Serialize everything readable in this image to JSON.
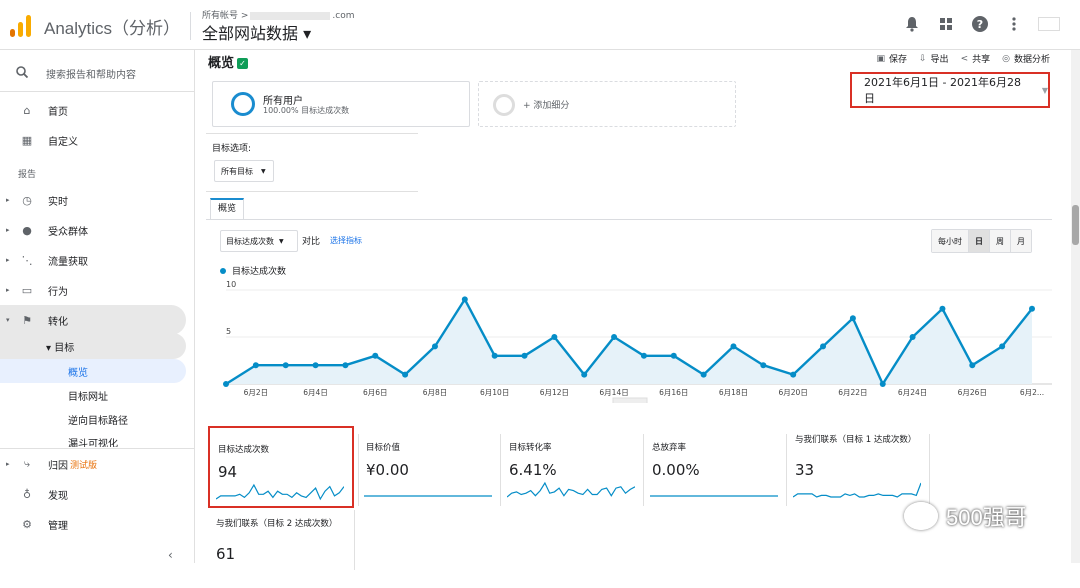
{
  "app": {
    "name": "Analytics（分析）"
  },
  "account": {
    "crumb_prefix": "所有帐号 >",
    "crumb_suffix": ".com",
    "view_name": "全部网站数据 ▾"
  },
  "header_icons": [
    "bell-icon",
    "apps-grid-icon",
    "help-icon",
    "more-vert-icon"
  ],
  "sidebar": {
    "search_placeholder": "搜索报告和帮助内容",
    "section_label": "报告",
    "items": [
      {
        "label": "首页",
        "icon": "home-icon"
      },
      {
        "label": "自定义",
        "icon": "dashboard-icon"
      },
      {
        "label": "实时",
        "icon": "clock-icon"
      },
      {
        "label": "受众群体",
        "icon": "person-icon"
      },
      {
        "label": "流量获取",
        "icon": "acquisition-icon"
      },
      {
        "label": "行为",
        "icon": "behavior-icon"
      },
      {
        "label": "转化",
        "icon": "flag-icon"
      },
      {
        "label": "▾ 目标",
        "icon": ""
      },
      {
        "label": "概览",
        "icon": ""
      },
      {
        "label": "目标网址",
        "icon": ""
      },
      {
        "label": "逆向目标路径",
        "icon": ""
      },
      {
        "label": "漏斗可视化",
        "icon": ""
      },
      {
        "label": "归因",
        "icon": "attribution-icon",
        "badge": "测试版"
      },
      {
        "label": "发现",
        "icon": "lightbulb-icon"
      },
      {
        "label": "管理",
        "icon": "gear-icon"
      }
    ],
    "collapse": "‹"
  },
  "page": {
    "title": "概览"
  },
  "actions": [
    {
      "label": "保存",
      "icon": "save-icon"
    },
    {
      "label": "导出",
      "icon": "export-icon"
    },
    {
      "label": "共享",
      "icon": "share-icon"
    },
    {
      "label": "数据分析",
      "icon": "insights-icon"
    }
  ],
  "segments": {
    "primary_title": "所有用户",
    "primary_sub": "100.00% 目标达成次数",
    "add": "+ 添加细分"
  },
  "date_range": "2021年6月1日 - 2021年6月28日",
  "goal_option": {
    "label": "目标选项:",
    "value": "所有目标"
  },
  "tabs": {
    "overview": "概览"
  },
  "chart_controls": {
    "metric": "目标达成次数",
    "vs": "对比",
    "choose_metric": "选择指标",
    "granularity": [
      "每小时",
      "日",
      "周",
      "月"
    ],
    "selected_granularity": "日"
  },
  "chart_data": {
    "type": "area",
    "series": [
      {
        "name": "目标达成次数",
        "values": [
          0,
          2,
          2,
          2,
          2,
          3,
          1,
          4,
          9,
          3,
          3,
          5,
          1,
          5,
          3,
          3,
          1,
          4,
          2,
          1,
          4,
          7,
          0,
          5,
          8,
          2,
          4,
          8
        ]
      }
    ],
    "x_tick_labels": [
      "6月2日",
      "6月4日",
      "6月6日",
      "6月8日",
      "6月10日",
      "6月12日",
      "6月14日",
      "6月16日",
      "6月18日",
      "6月20日",
      "6月22日",
      "6月24日",
      "6月26日",
      "6月2..."
    ],
    "y_tick_labels": [
      "10",
      "5"
    ],
    "ylim": [
      0,
      10
    ],
    "color": "#058dc7"
  },
  "tiles": [
    {
      "name": "目标达成次数",
      "value": "94"
    },
    {
      "name": "目标价值",
      "value": "¥0.00"
    },
    {
      "name": "目标转化率",
      "value": "6.41%"
    },
    {
      "name": "总放弃率",
      "value": "0.00%"
    },
    {
      "name": "与我们联系（目标 1 达成次数）",
      "value": "33"
    },
    {
      "name": "与我们联系（目标 2 达成次数）",
      "value": "61"
    }
  ],
  "watermark": "500强哥"
}
